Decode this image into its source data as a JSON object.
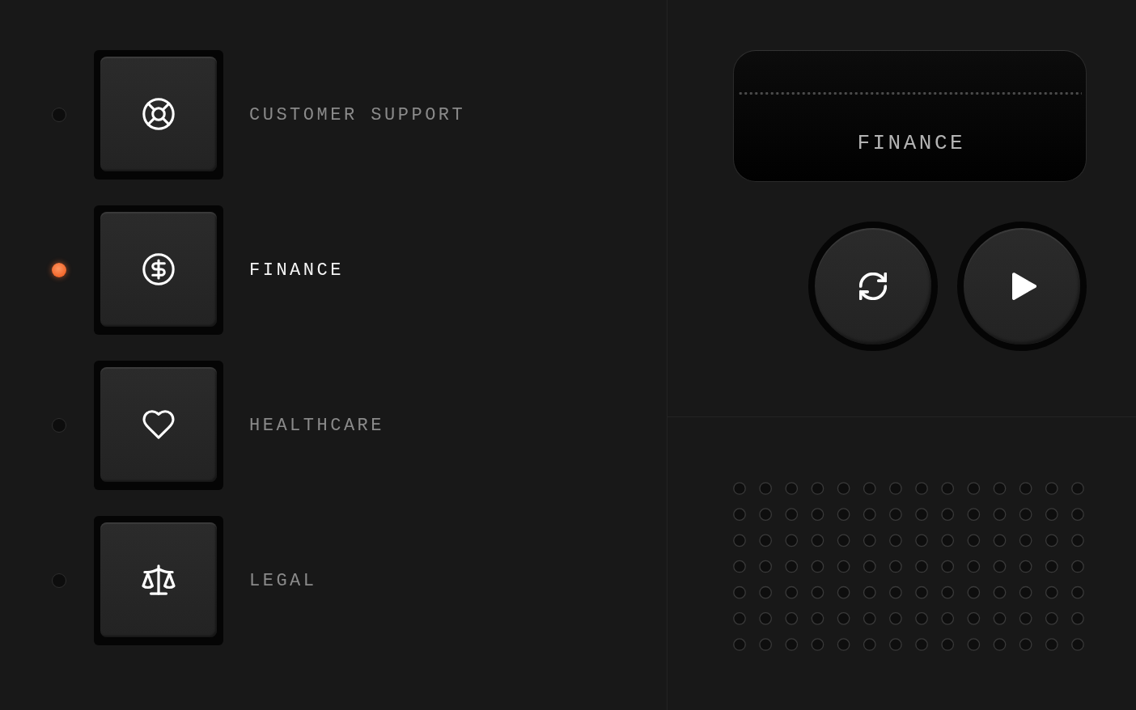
{
  "industries": [
    {
      "label": "CUSTOMER SUPPORT",
      "selected": false
    },
    {
      "label": "FINANCE",
      "selected": true
    },
    {
      "label": "HEALTHCARE",
      "selected": false
    },
    {
      "label": "LEGAL",
      "selected": false
    }
  ],
  "display": {
    "text": "FINANCE"
  },
  "controls": [
    {
      "kind": "refresh"
    },
    {
      "kind": "play"
    }
  ]
}
